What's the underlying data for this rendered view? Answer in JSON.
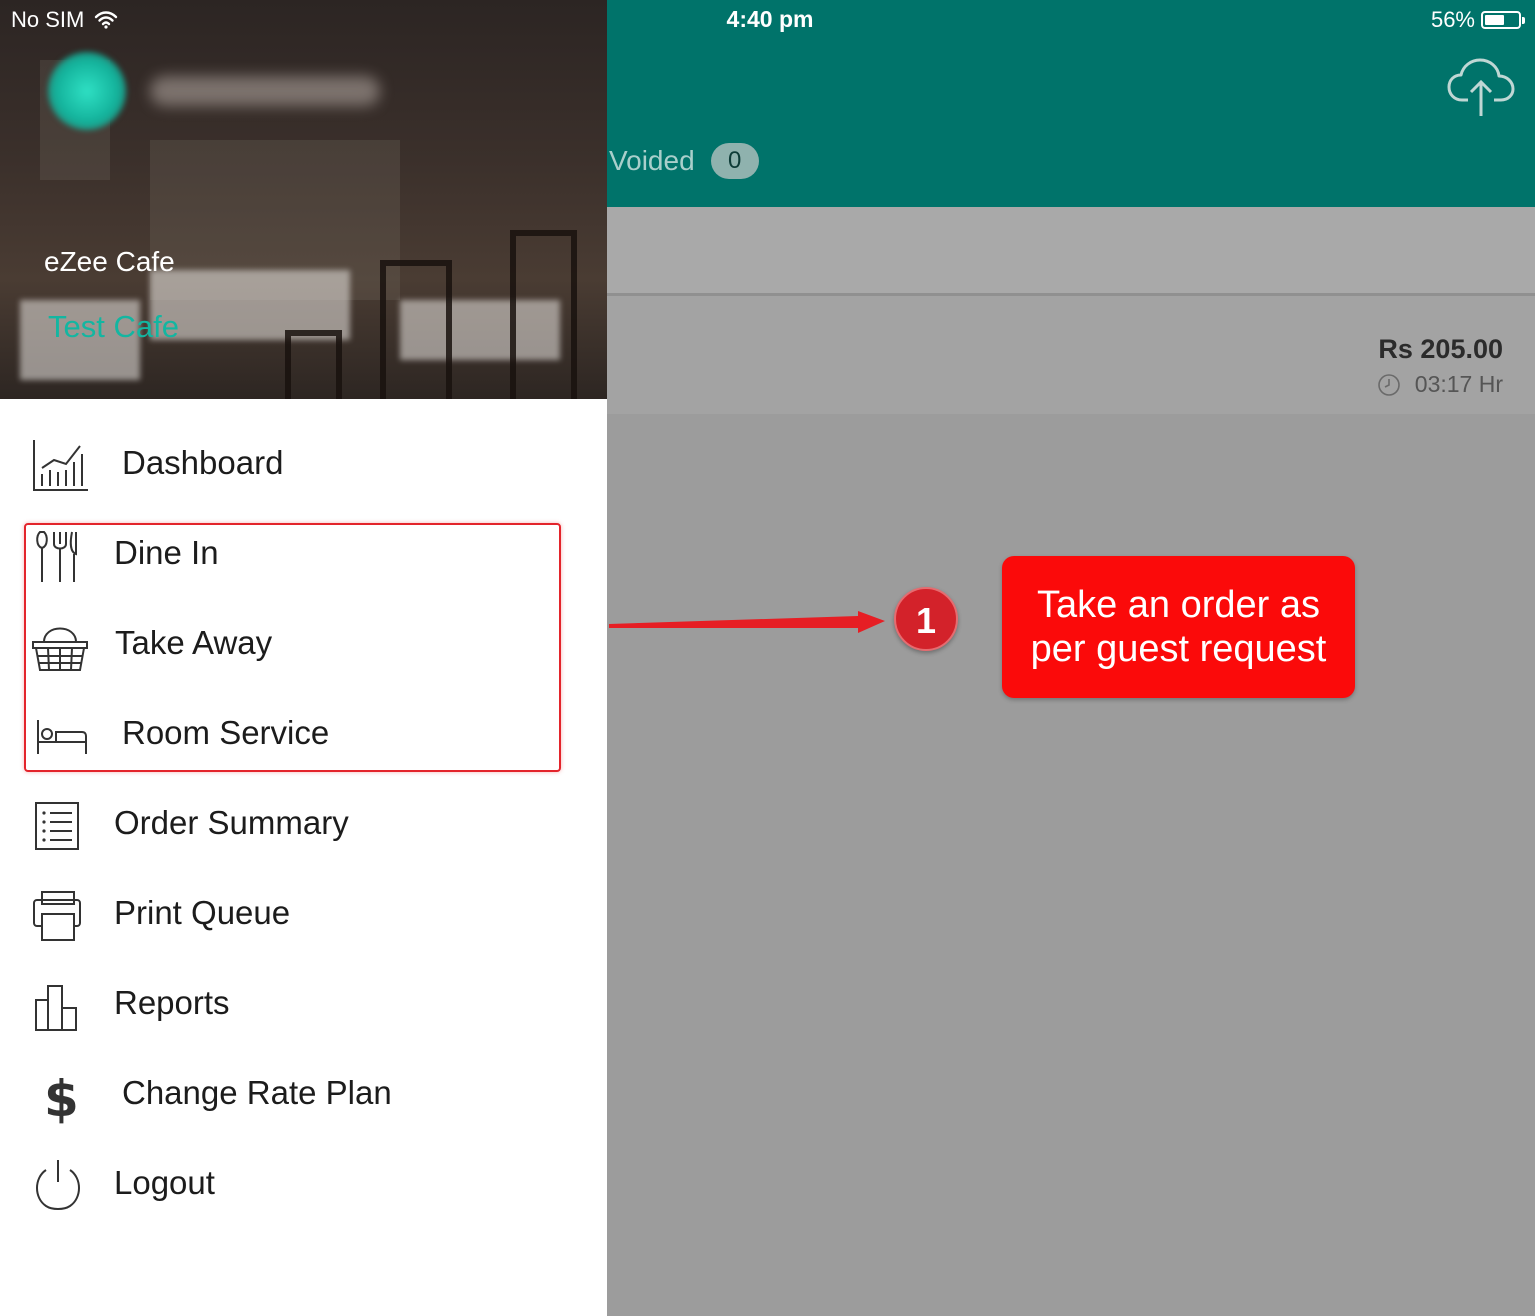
{
  "status_bar": {
    "carrier": "No SIM",
    "time": "4:40 pm",
    "battery": "56%",
    "battery_level": 0.56
  },
  "main": {
    "tab_voided": {
      "label": "Voided",
      "count": "0"
    },
    "order": {
      "amount": "Rs 205.00",
      "elapsed": "03:17 Hr"
    }
  },
  "drawer": {
    "cafe_name": "eZee Cafe",
    "outlet_name": "Test Cafe",
    "menu": [
      {
        "label": "Dashboard",
        "icon": "chart-icon"
      },
      {
        "label": "Dine In",
        "icon": "fork-knife-icon"
      },
      {
        "label": "Take Away",
        "icon": "basket-icon"
      },
      {
        "label": "Room Service",
        "icon": "bed-icon"
      },
      {
        "label": "Order Summary",
        "icon": "list-icon"
      },
      {
        "label": "Print Queue",
        "icon": "printer-icon"
      },
      {
        "label": "Reports",
        "icon": "bar-chart-icon"
      },
      {
        "label": "Change Rate Plan",
        "icon": "dollar-icon"
      },
      {
        "label": "Logout",
        "icon": "power-icon"
      }
    ]
  },
  "annotation": {
    "step": "1",
    "text": "Take an order as per guest request"
  },
  "colors": {
    "header": "#00736a",
    "accent": "#13b6a1",
    "callout": "#fb0a0a",
    "highlight": "#e3242b"
  }
}
